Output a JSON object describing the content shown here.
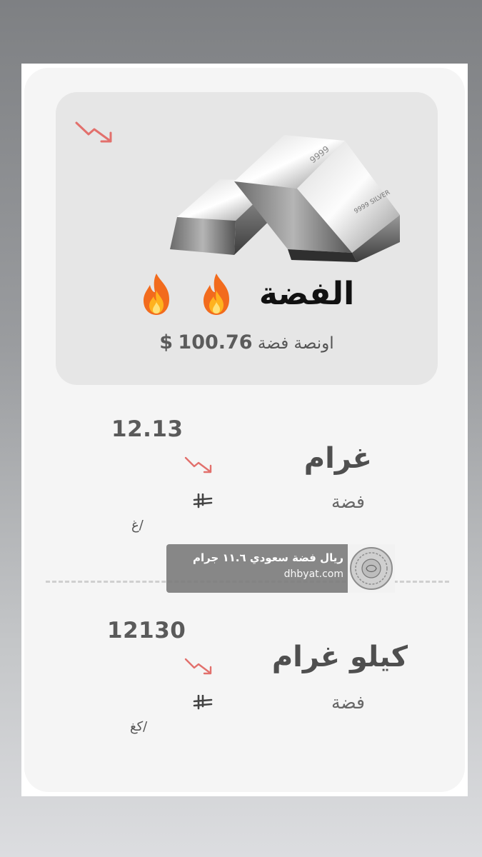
{
  "hero": {
    "title": "الفضة",
    "ounce_label": "اونصة فضة",
    "ounce_price": "100.76",
    "currency_symbol": "$",
    "trend": "down",
    "trend_color": "#e2706c"
  },
  "rows": [
    {
      "unit": "غرام",
      "metal": "فضة",
      "price": "12.13",
      "per": "/غ",
      "trend": "down"
    },
    {
      "unit": "كيلو غرام",
      "metal": "فضة",
      "price": "12130",
      "per": "/كغ",
      "trend": "down"
    }
  ],
  "ad": {
    "title": "ريال فضة سعودي ١١.٦ جرام",
    "domain": "dhbyat.com"
  },
  "icons": {
    "trend": "trend-down-icon",
    "flame": "fire-emoji-icon",
    "currency": "saudi-riyal-icon"
  }
}
